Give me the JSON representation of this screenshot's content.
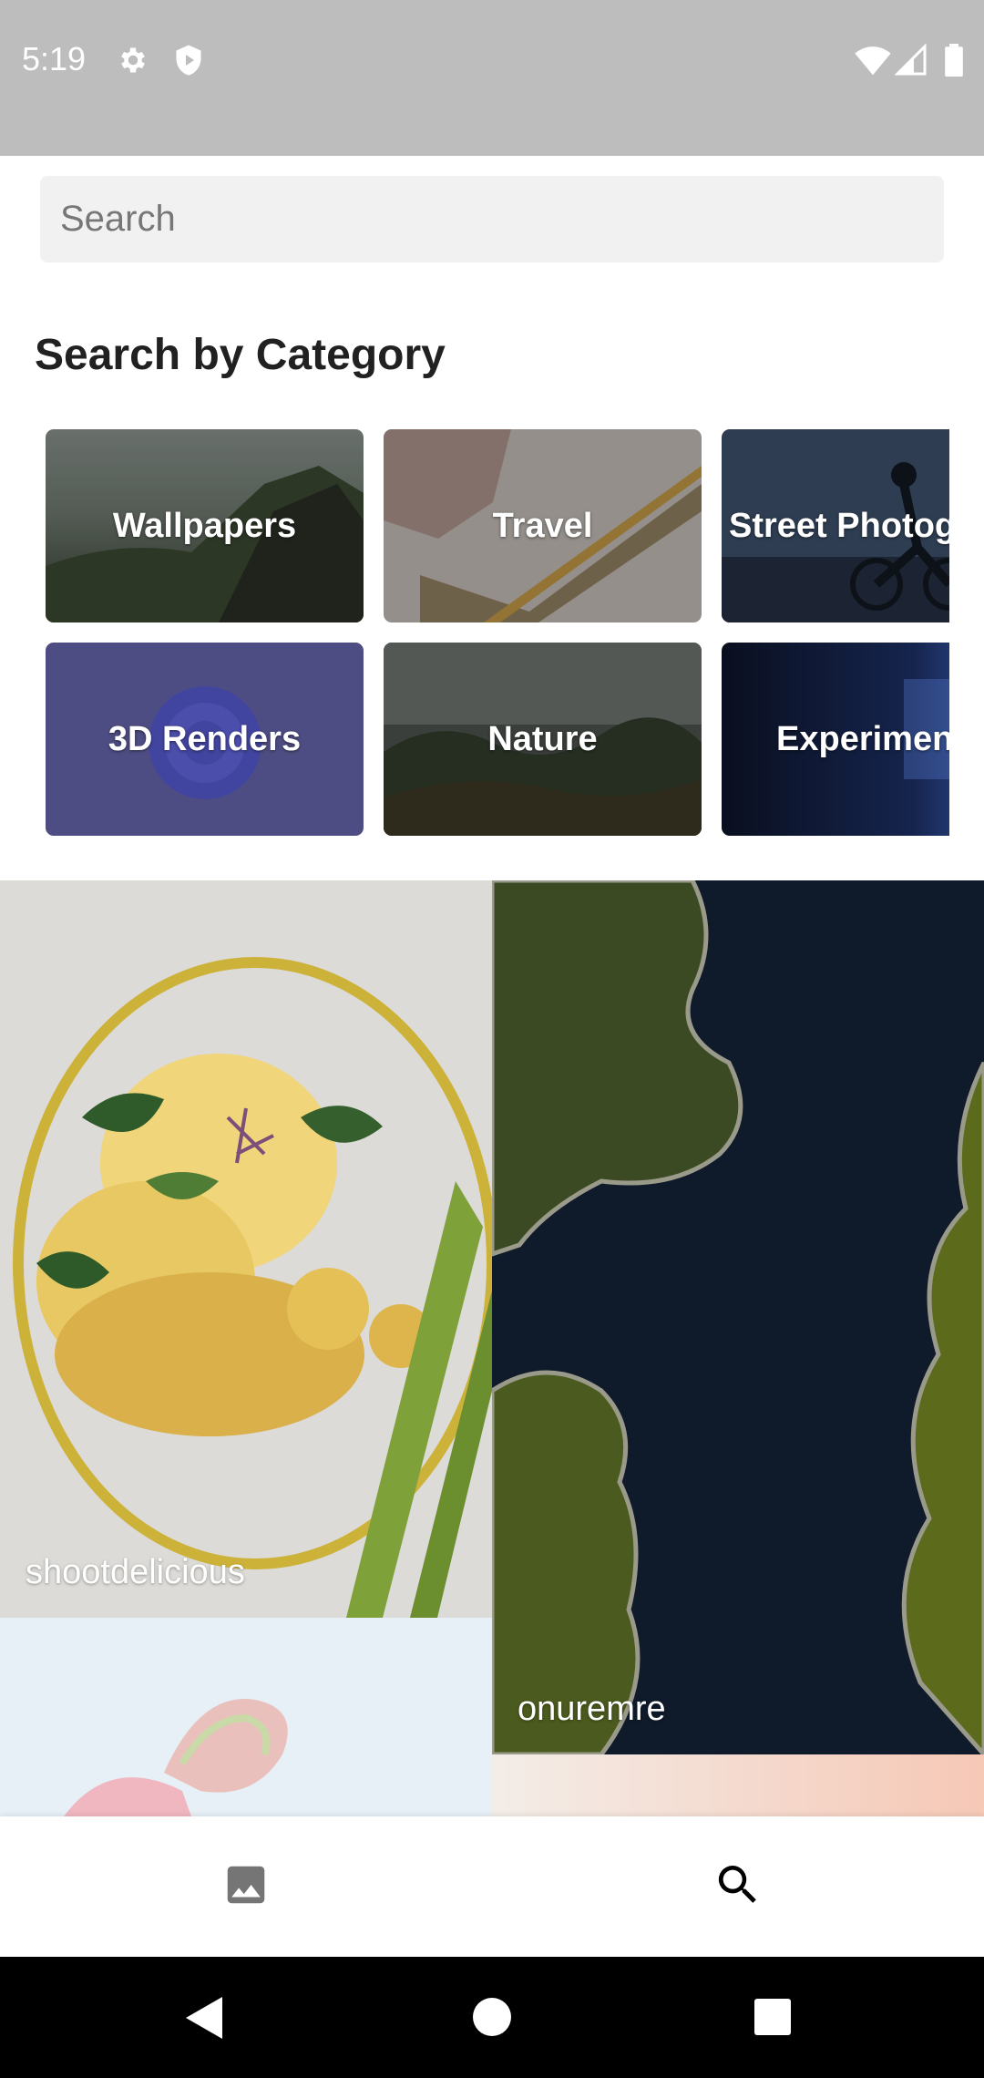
{
  "status_bar": {
    "time": "5:19",
    "icons_left": [
      "settings-icon",
      "shield-play-icon"
    ],
    "icons_right": [
      "wifi-icon",
      "signal-icon",
      "battery-icon"
    ]
  },
  "search": {
    "placeholder": "Search",
    "value": ""
  },
  "categories": {
    "title": "Search by Category",
    "items": [
      {
        "label": "Wallpapers"
      },
      {
        "label": "Travel"
      },
      {
        "label": "Street Photography"
      },
      {
        "label": "3D Renders"
      },
      {
        "label": "Nature"
      },
      {
        "label": "Experimental"
      }
    ]
  },
  "photos": [
    {
      "credit": "shootdelicious"
    },
    {
      "credit": "onuremre"
    },
    {
      "credit": ""
    },
    {
      "credit": ""
    }
  ],
  "bottom_nav": {
    "items": [
      {
        "icon": "image-icon",
        "active": false
      },
      {
        "icon": "search-icon",
        "active": true
      }
    ]
  },
  "system_nav": {
    "items": [
      "back-icon",
      "home-icon",
      "recents-icon"
    ]
  },
  "colors": {
    "status_bar": "#bdbdbd",
    "search_bg": "#f1f1f1",
    "nav_inactive": "#757575",
    "nav_active": "#000000"
  }
}
